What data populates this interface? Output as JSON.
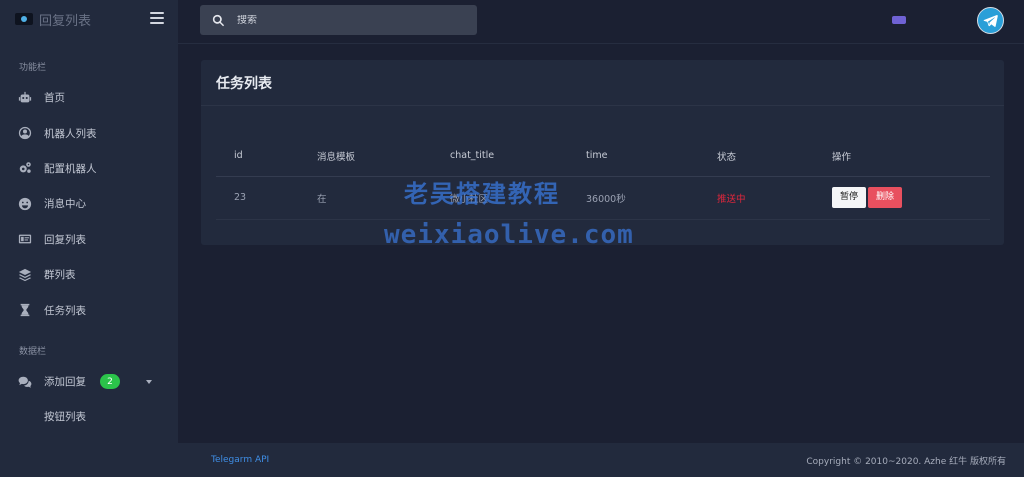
{
  "brand": {
    "title": "回复列表"
  },
  "sidebar": {
    "section_func": "功能栏",
    "items": [
      {
        "label": "首页",
        "icon": "robot-icon"
      },
      {
        "label": "机器人列表",
        "icon": "user-circle-icon"
      },
      {
        "label": "配置机器人",
        "icon": "gears-icon"
      },
      {
        "label": "消息中心",
        "icon": "smile-icon"
      },
      {
        "label": "回复列表",
        "icon": "id-card-icon"
      },
      {
        "label": "群列表",
        "icon": "layers-icon"
      },
      {
        "label": "任务列表",
        "icon": "hourglass-icon"
      }
    ],
    "section_data": "数据栏",
    "data_items": [
      {
        "label": "添加回复",
        "icon": "comments-icon",
        "badge": "2"
      }
    ],
    "sub_items": [
      {
        "label": "按钮列表"
      }
    ]
  },
  "topbar": {
    "search_placeholder": "搜索"
  },
  "card": {
    "title": "任务列表",
    "columns": [
      "id",
      "消息模板",
      "chat_title",
      "time",
      "状态",
      "操作"
    ],
    "rows": [
      {
        "id": "23",
        "template": "在",
        "chat_title": "微小社区",
        "time": "36000秒",
        "status": "推送中",
        "pause_label": "暂停",
        "delete_label": "删除"
      }
    ]
  },
  "watermark": {
    "line1": "老吴搭建教程",
    "line2": "weixiaolive.com"
  },
  "footer": {
    "link": "Telegarm API",
    "copyright": "Copyright © 2010~2020. Azhe 红牛 版权所有"
  },
  "colors": {
    "accent": "#2a9fd8",
    "status_red": "#e0263c",
    "badge_green": "#2bc34a",
    "delete_red": "#e8505f"
  }
}
